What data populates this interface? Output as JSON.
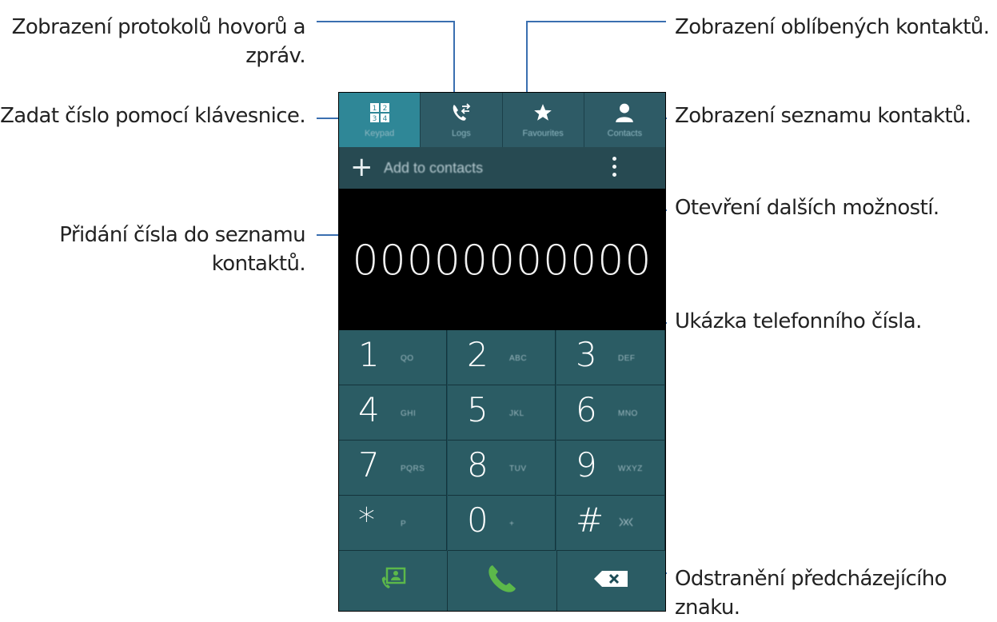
{
  "callouts": {
    "logs": "Zobrazení protokolů hovorů a\nzpráv.",
    "logs_line1": "Zobrazení protokolů hovorů a",
    "logs_line2": "zpráv.",
    "keypad": "Zadat číslo pomocí klávesnice.",
    "add_line1": "Přidání čísla do seznamu",
    "add_line2": "kontaktů.",
    "favourites": "Zobrazení oblíbených kontaktů.",
    "contacts": "Zobrazení seznamu kontaktů.",
    "more": "Otevření dalších možností.",
    "preview": "Ukázka telefonního čísla.",
    "delete_line1": "Odstranění předcházejícího",
    "delete_line2": "znaku."
  },
  "tabs": [
    {
      "label": "Keypad",
      "icon": "keypad-icon",
      "active": true
    },
    {
      "label": "Logs",
      "icon": "logs-icon",
      "active": false
    },
    {
      "label": "Favourites",
      "icon": "star-icon",
      "active": false
    },
    {
      "label": "Contacts",
      "icon": "contact-icon",
      "active": false
    }
  ],
  "add_to_contacts": "Add to contacts",
  "display_number": "00000000000",
  "keys": [
    {
      "digit": "1",
      "sub": "QO"
    },
    {
      "digit": "2",
      "sub": "ABC"
    },
    {
      "digit": "3",
      "sub": "DEF"
    },
    {
      "digit": "4",
      "sub": "GHI"
    },
    {
      "digit": "5",
      "sub": "JKL"
    },
    {
      "digit": "6",
      "sub": "MNO"
    },
    {
      "digit": "7",
      "sub": "PQRS"
    },
    {
      "digit": "8",
      "sub": "TUV"
    },
    {
      "digit": "9",
      "sub": "WXYZ"
    },
    {
      "digit": "*",
      "sub": "P"
    },
    {
      "digit": "0",
      "sub": "+"
    },
    {
      "digit": "#",
      "sub": ""
    }
  ],
  "actions": [
    {
      "name": "contacts-card-icon"
    },
    {
      "name": "call-icon"
    },
    {
      "name": "backspace-icon"
    }
  ],
  "colors": {
    "accent_line": "#3a6fb0",
    "active_tab": "#2f8797",
    "call_green": "#5cb84a"
  }
}
